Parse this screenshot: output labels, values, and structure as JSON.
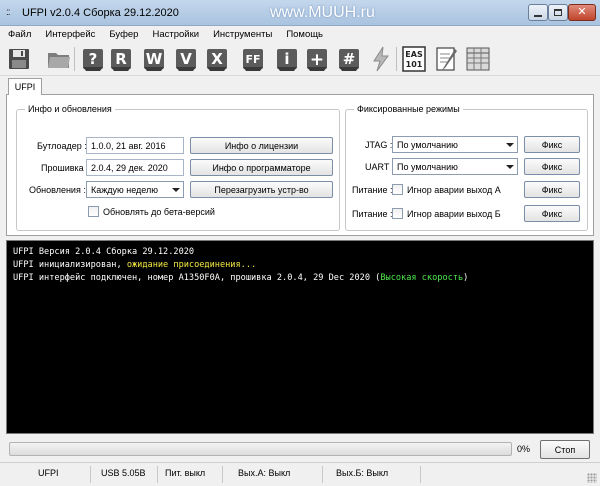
{
  "window": {
    "title": "UFPI v2.0.4 Сборка 29.12.2020",
    "watermark": "www.MUUH.ru"
  },
  "menu": [
    "Файл",
    "Интерфейс",
    "Буфер",
    "Настройки",
    "Инструменты",
    "Помощь"
  ],
  "toolbar": {
    "icon_letters": {
      "help": "?",
      "read": "R",
      "write": "W",
      "verify": "V",
      "erase": "X",
      "ff": "FF",
      "info": "i",
      "plus": "+",
      "hash": "#",
      "eas": "EAS",
      "eas_num": "101"
    }
  },
  "tabs": {
    "active": "UFPI"
  },
  "info_group": {
    "title": "Инфо и обновления",
    "bootloader_label": "Бутлоадер :",
    "bootloader_value": "1.0.0, 21 авг. 2016",
    "firmware_label": "Прошивка :",
    "firmware_value": "2.0.4, 29 дек. 2020",
    "updates_label": "Обновления :",
    "updates_value": "Каждую неделю",
    "beta_label": "Обновлять до бета-версий",
    "license_button": "Инфо о лицензии",
    "programmer_button": "Инфо о программаторе",
    "reboot_button": "Перезагрузить устр-во"
  },
  "fixed_group": {
    "title": "Фиксированные режимы",
    "jtag_label": "JTAG :",
    "jtag_value": "По умолчанию",
    "uart_label": "UART :",
    "uart_value": "По умолчанию",
    "power_a_label": "Питание :",
    "power_a_check": "Игнор аварии выход А",
    "power_b_label": "Питание :",
    "power_b_check": "Игнор аварии выход Б",
    "fix_label": "Фикс"
  },
  "console": {
    "line1": "UFPI Версия 2.0.4 Сборка 29.12.2020",
    "line2_prefix": "UFPI инициализирован, ",
    "line2_highlight": "ожидание присоединения...",
    "line3_prefix": "UFPI интерфейс подключен, номер A1350F0A, прошивка 2.0.4, 29 Dec 2020 (",
    "line3_highlight": "Высокая скорость",
    "line3_suffix": ")"
  },
  "progress": {
    "value": 0,
    "label": "0%"
  },
  "stop_button": "Стоп",
  "statusbar": {
    "device": "UFPI",
    "usb": "USB 5.05В",
    "power": "Пит. выкл",
    "out_a": "Вых.А: Выкл",
    "out_b": "Вых.Б: Выкл"
  },
  "colors": {
    "console_bg": "#000000",
    "console_yellow": "#f3e742",
    "console_green": "#4de84d"
  }
}
